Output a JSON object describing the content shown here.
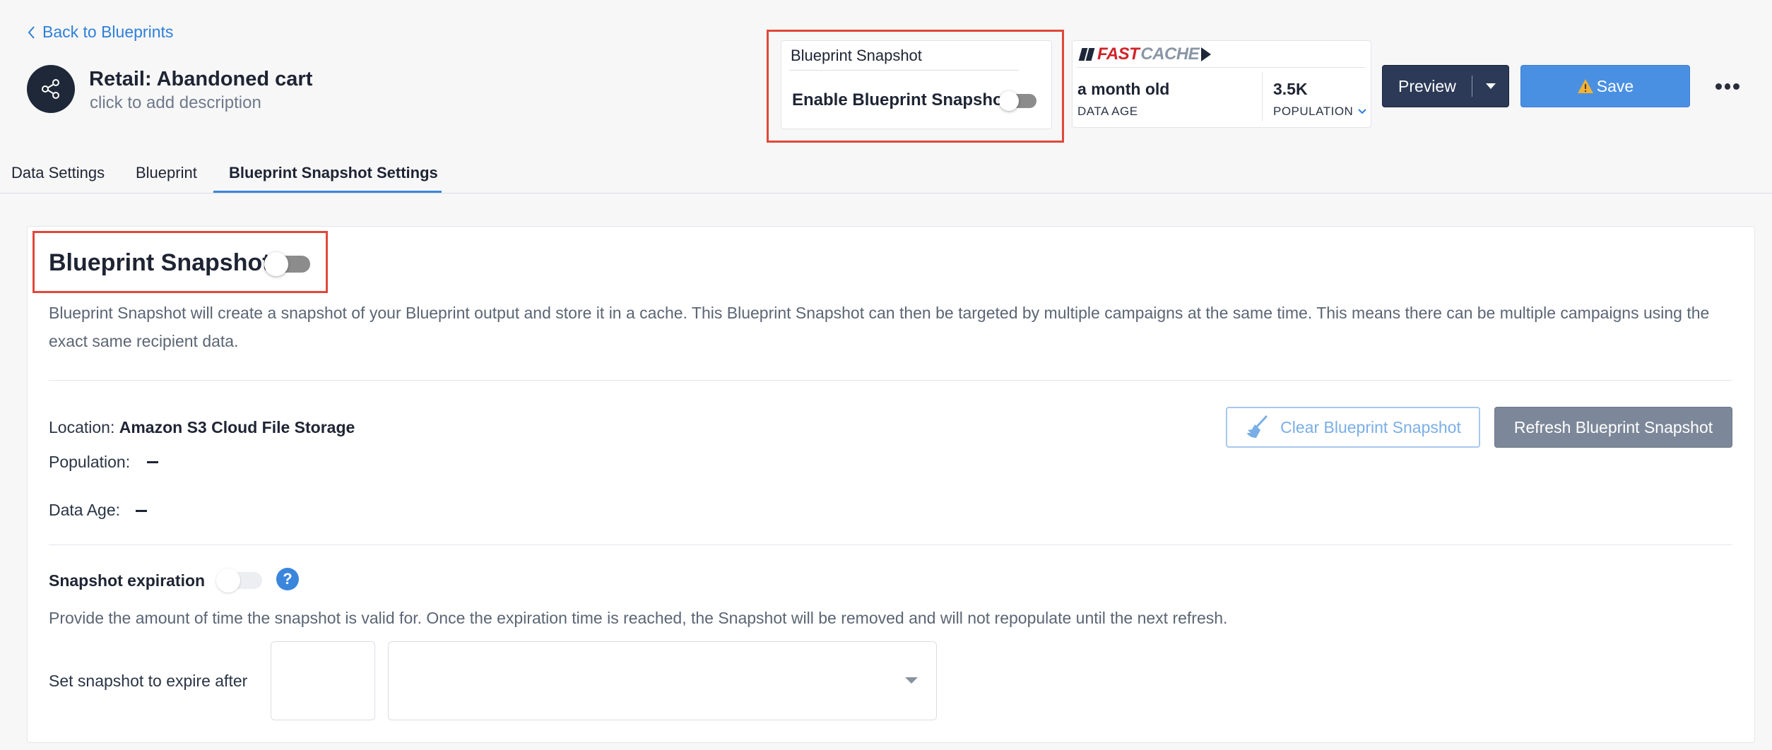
{
  "header": {
    "back_label": "Back to Blueprints",
    "title": "Retail: Abandoned cart",
    "description_placeholder": "click to add description"
  },
  "snapshot_mini": {
    "title": "Blueprint Snapshot",
    "toggle_label": "Enable Blueprint Snapshot",
    "enabled": false
  },
  "fastcache": {
    "logo_fast": "FAST",
    "logo_cache": "CACHE",
    "data_age_value": "a month old",
    "data_age_label": "DATA AGE",
    "population_value": "3.5K",
    "population_label": "POPULATION"
  },
  "actions": {
    "preview_label": "Preview",
    "save_label": "Save"
  },
  "tabs": [
    {
      "label": "Data Settings",
      "active": false
    },
    {
      "label": "Blueprint",
      "active": false
    },
    {
      "label": "Blueprint Snapshot Settings",
      "active": true
    }
  ],
  "snapshot": {
    "title": "Blueprint Snapshot",
    "enabled": false,
    "description": "Blueprint Snapshot will create a snapshot of your Blueprint output and store it in a cache. This Blueprint Snapshot can then be targeted by multiple campaigns at the same time. This means there can be multiple campaigns using the exact same recipient data.",
    "location_label": "Location:",
    "location_value": "Amazon S3 Cloud File Storage",
    "population_label": "Population:",
    "data_age_label": "Data Age:",
    "clear_label": "Clear Blueprint Snapshot",
    "refresh_label": "Refresh Blueprint Snapshot"
  },
  "expiration": {
    "label": "Snapshot expiration",
    "enabled": false,
    "help_icon": "?",
    "description": "Provide the amount of time the snapshot is valid for. Once the expiration time is reached, the Snapshot will be removed and will not repopulate until the next refresh.",
    "expire_after_label": "Set snapshot to expire after",
    "amount_value": "",
    "unit_value": ""
  },
  "colors": {
    "accent": "#4a90e2",
    "highlight_box": "#e0483a",
    "preview_button": "#2c3a58",
    "refresh_button": "#7c8899"
  }
}
